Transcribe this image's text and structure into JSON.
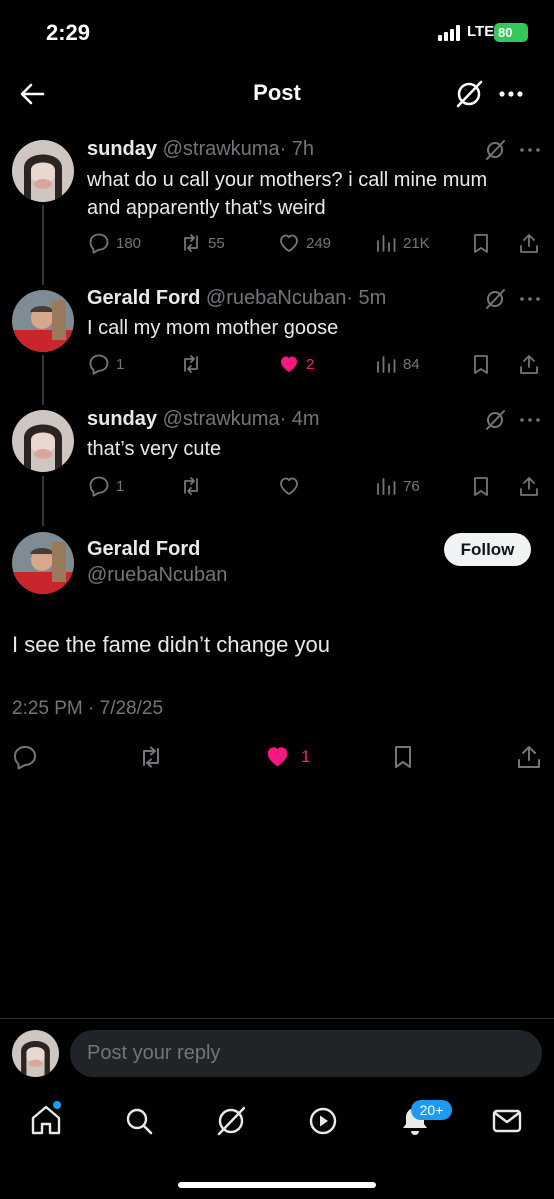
{
  "status_bar": {
    "time": "2:29",
    "network": "LTE",
    "battery": "80"
  },
  "header": {
    "title": "Post"
  },
  "thread": [
    {
      "name": "sunday",
      "handle": "@strawkuma",
      "time": "· 7h",
      "text_lines": [
        "what do u call your mothers? i call mine mum",
        "and apparently that’s weird"
      ],
      "replies": "180",
      "reposts": "55",
      "likes": "249",
      "views": "21K",
      "liked": false
    },
    {
      "name": "Gerald Ford",
      "handle": "@ruebaNcuban",
      "time": "· 5m",
      "text_lines": [
        "I call my mom mother goose"
      ],
      "replies": "1",
      "reposts": "",
      "likes": "2",
      "views": "84",
      "liked": true
    },
    {
      "name": "sunday",
      "handle": "@strawkuma",
      "time": "· 4m",
      "text_lines": [
        "that’s very cute"
      ],
      "replies": "1",
      "reposts": "",
      "likes": "",
      "views": "76",
      "liked": false
    }
  ],
  "main_post": {
    "name": "Gerald Ford",
    "handle": "@ruebaNcuban",
    "follow_label": "Follow",
    "text": "I see the fame didn’t change you",
    "timestamp": "2:25 PM · 7/28/25",
    "likes": "1",
    "liked": true
  },
  "reply_bar": {
    "placeholder": "Post your reply"
  },
  "tab_bar": {
    "notifications_badge": "20+"
  },
  "colors": {
    "like_pink": "#f91880",
    "accent_blue": "#1d9bf0",
    "muted": "#71767b"
  }
}
